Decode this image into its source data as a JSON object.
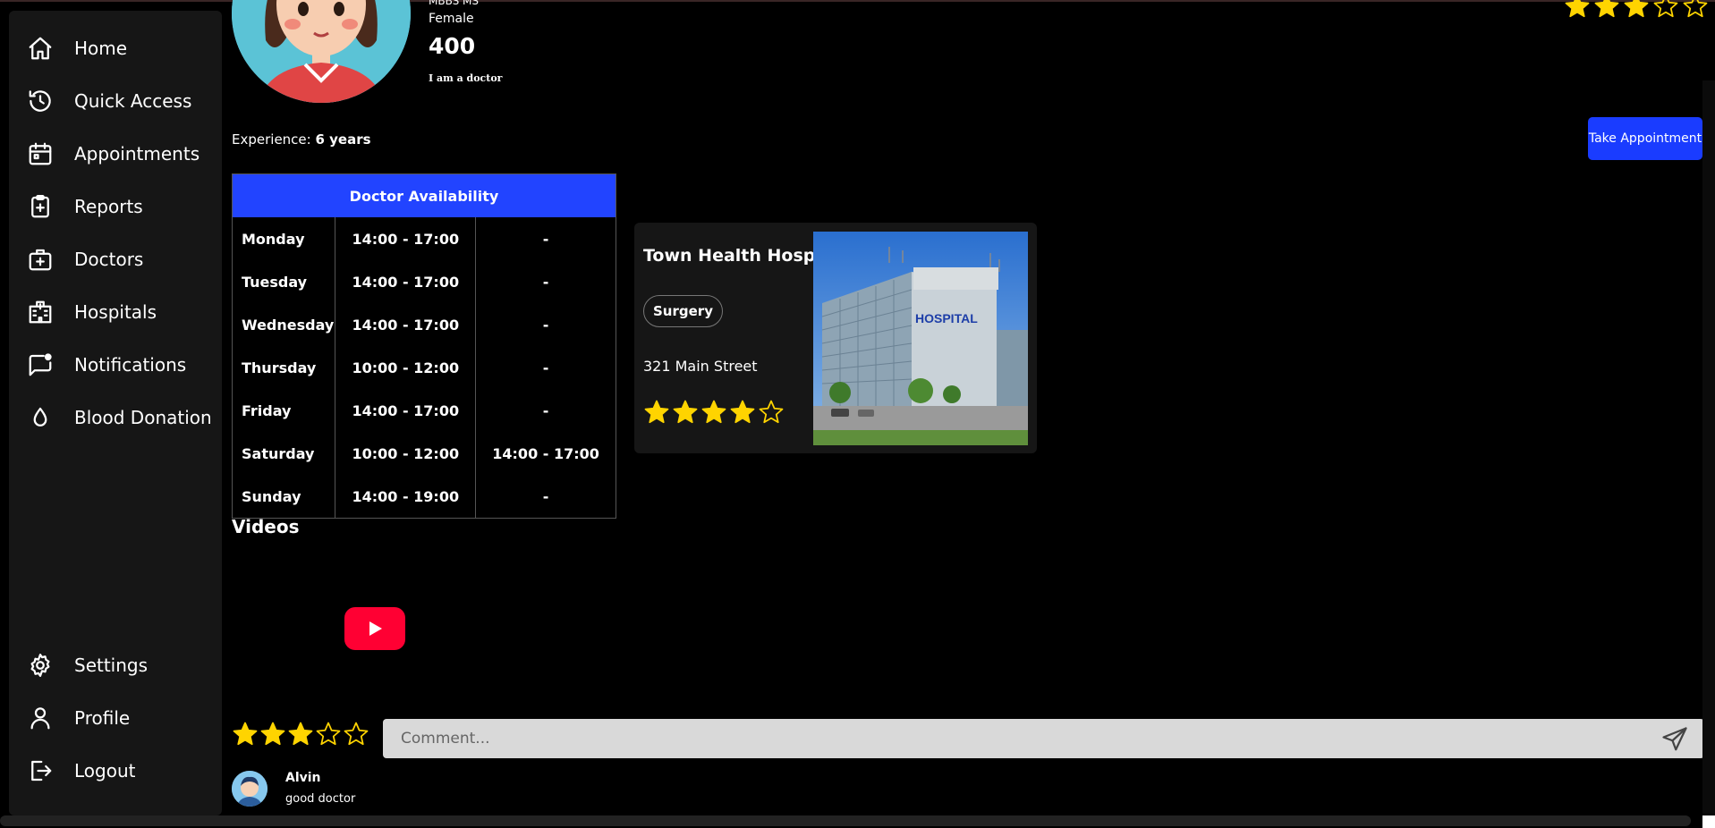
{
  "sidebar": {
    "items": [
      {
        "label": "Home",
        "icon": "home-icon"
      },
      {
        "label": "Quick Access",
        "icon": "history-icon"
      },
      {
        "label": "Appointments",
        "icon": "calendar-icon"
      },
      {
        "label": "Reports",
        "icon": "clipboard-icon"
      },
      {
        "label": "Doctors",
        "icon": "medical-bag-icon"
      },
      {
        "label": "Hospitals",
        "icon": "hospital-icon"
      },
      {
        "label": "Notifications",
        "icon": "chat-notification-icon"
      },
      {
        "label": "Blood Donation",
        "icon": "drop-icon"
      },
      {
        "label": "Settings",
        "icon": "gear-icon"
      },
      {
        "label": "Profile",
        "icon": "user-icon"
      },
      {
        "label": "Logout",
        "icon": "logout-icon"
      }
    ]
  },
  "doctor": {
    "degree": "MBBS MS",
    "gender": "Female",
    "fee": "400",
    "about": "I am a doctor",
    "experience_label": "Experience:",
    "experience_value": "6 years",
    "rating": 3
  },
  "actions": {
    "take_appointment": "Take Appointment"
  },
  "availability": {
    "title": "Doctor Availability",
    "rows": [
      {
        "day": "Monday",
        "slot1": "14:00 - 17:00",
        "slot2": "-"
      },
      {
        "day": "Tuesday",
        "slot1": "14:00 - 17:00",
        "slot2": "-"
      },
      {
        "day": "Wednesday",
        "slot1": "14:00 - 17:00",
        "slot2": "-"
      },
      {
        "day": "Thursday",
        "slot1": "10:00 - 12:00",
        "slot2": "-"
      },
      {
        "day": "Friday",
        "slot1": "14:00 - 17:00",
        "slot2": "-"
      },
      {
        "day": "Saturday",
        "slot1": "10:00 - 12:00",
        "slot2": "14:00 - 17:00"
      },
      {
        "day": "Sunday",
        "slot1": "14:00 - 19:00",
        "slot2": "-"
      }
    ]
  },
  "hospital": {
    "name": "Town Health Hospital",
    "tag": "Surgery",
    "address": "321 Main Street",
    "rating": 4,
    "sign_text": "HOSPITAL"
  },
  "videos": {
    "heading": "Videos"
  },
  "review": {
    "rating": 3,
    "comment_placeholder": "Comment...",
    "comments": [
      {
        "name": "Alvin",
        "text": "good doctor"
      }
    ]
  },
  "colors": {
    "accent": "#2244ff",
    "star": "#ffd400",
    "youtube": "#ff0033",
    "sidebar": "#161616"
  }
}
